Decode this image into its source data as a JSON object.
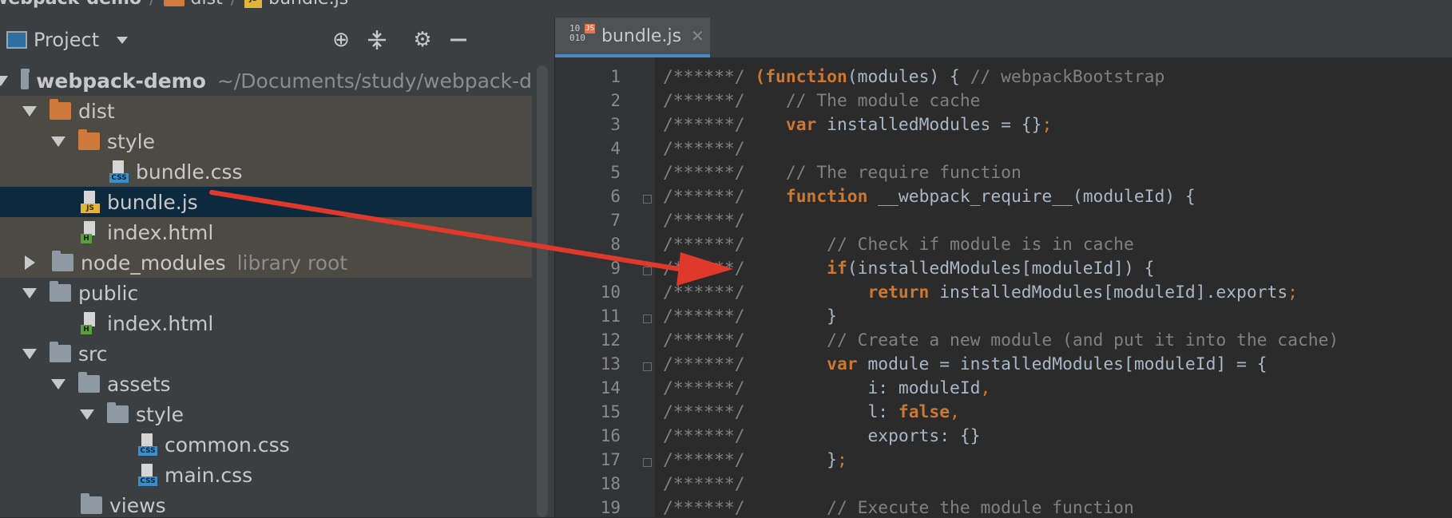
{
  "breadcrumb": {
    "items": [
      "webpack-demo",
      "dist",
      "bundle.js"
    ]
  },
  "project": {
    "title": "Project"
  },
  "tree": [
    {
      "label": "webpack-demo",
      "extra": "~/Documents/study/webpack-d"
    },
    {
      "label": "dist"
    },
    {
      "label": "style"
    },
    {
      "label": "bundle.css",
      "badge": "CSS"
    },
    {
      "label": "bundle.js",
      "badge": "JS"
    },
    {
      "label": "index.html",
      "badge": "H"
    },
    {
      "label": "node_modules",
      "extra": "library root"
    },
    {
      "label": "public"
    },
    {
      "label": "index.html",
      "badge": "H"
    },
    {
      "label": "src"
    },
    {
      "label": "assets"
    },
    {
      "label": "style"
    },
    {
      "label": "common.css",
      "badge": "CSS"
    },
    {
      "label": "main.css",
      "badge": "CSS"
    },
    {
      "label": "views"
    }
  ],
  "editor": {
    "tab": {
      "label": "bundle.js",
      "binary": "10\n010",
      "badge": "JS",
      "close": "✕"
    },
    "line_numbers": [
      "1",
      "2",
      "3",
      "4",
      "5",
      "6",
      "7",
      "8",
      "9",
      "10",
      "11",
      "12",
      "13",
      "14",
      "15",
      "16",
      "17",
      "18",
      "19"
    ],
    "code": [
      [
        [
          "cm",
          "/******/ "
        ],
        [
          "kw",
          "("
        ],
        [
          "kw",
          "function"
        ],
        [
          "pl",
          "(modules) { "
        ],
        [
          "cm",
          "// webpackBootstrap"
        ]
      ],
      [
        [
          "cm",
          "/******/    // The module cache"
        ]
      ],
      [
        [
          "cm",
          "/******/    "
        ],
        [
          "kw",
          "var "
        ],
        [
          "pl",
          "installedModules = {}"
        ],
        [
          "pn",
          ";"
        ]
      ],
      [
        [
          "cm",
          "/******/"
        ]
      ],
      [
        [
          "cm",
          "/******/    // The require function"
        ]
      ],
      [
        [
          "cm",
          "/******/    "
        ],
        [
          "kw",
          "function "
        ],
        [
          "pl",
          "__webpack_require__(moduleId) {"
        ]
      ],
      [
        [
          "cm",
          "/******/"
        ]
      ],
      [
        [
          "cm",
          "/******/        // Check if module is in cache"
        ]
      ],
      [
        [
          "cm",
          "/******/        "
        ],
        [
          "kw",
          "if"
        ],
        [
          "pl",
          "(installedModules[moduleId]) {"
        ]
      ],
      [
        [
          "cm",
          "/******/            "
        ],
        [
          "kw",
          "return "
        ],
        [
          "pl",
          "installedModules[moduleId].exports"
        ],
        [
          "pn",
          ";"
        ]
      ],
      [
        [
          "cm",
          "/******/        "
        ],
        [
          "pl",
          "}"
        ]
      ],
      [
        [
          "cm",
          "/******/        // Create a new module (and put it into the cache)"
        ]
      ],
      [
        [
          "cm",
          "/******/        "
        ],
        [
          "kw",
          "var "
        ],
        [
          "pl",
          "module = installedModules[moduleId] = {"
        ]
      ],
      [
        [
          "cm",
          "/******/            "
        ],
        [
          "pl",
          "i: moduleId"
        ],
        [
          "pn",
          ","
        ]
      ],
      [
        [
          "cm",
          "/******/            "
        ],
        [
          "pl",
          "l: "
        ],
        [
          "kw",
          "false"
        ],
        [
          "pn",
          ","
        ]
      ],
      [
        [
          "cm",
          "/******/            "
        ],
        [
          "pl",
          "exports: {}"
        ]
      ],
      [
        [
          "cm",
          "/******/        "
        ],
        [
          "pl",
          "}"
        ],
        [
          "pn",
          ";"
        ]
      ],
      [
        [
          "cm",
          "/******/"
        ]
      ],
      [
        [
          "cm",
          "/******/        // Execute the module function"
        ]
      ]
    ]
  },
  "colors": {
    "annotation": "#e0392b",
    "selection": "#0d293e",
    "accent": "#4a88c7"
  }
}
